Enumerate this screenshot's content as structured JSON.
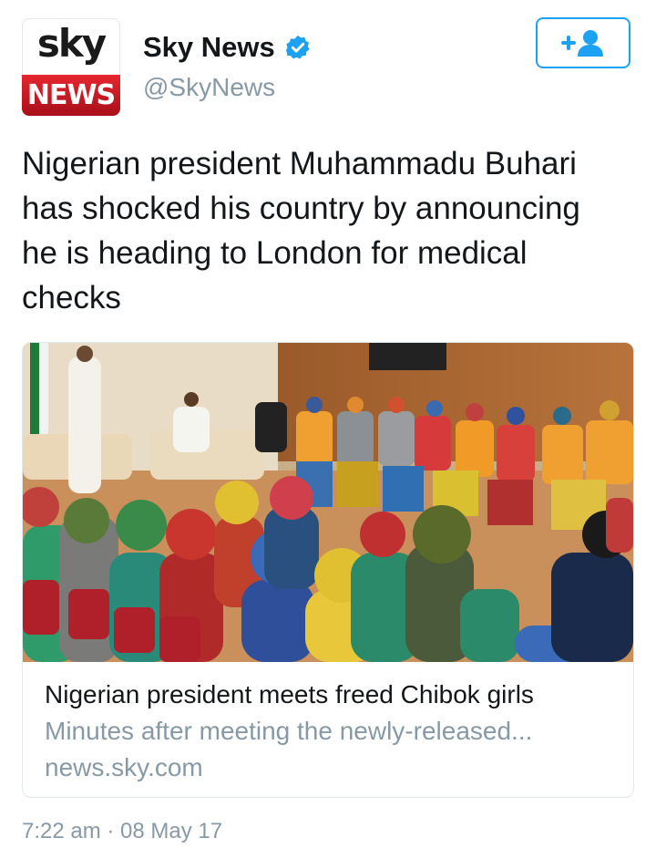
{
  "author": {
    "logo_top": "sky",
    "logo_bottom": "NEWS",
    "display_name": "Sky News",
    "handle": "@SkyNews",
    "verified": true
  },
  "follow_button": {
    "icon": "follow-user-icon",
    "color": "#1da1f2"
  },
  "tweet": {
    "text": "Nigerian president Muhammadu Buhari has shocked his country by announcing he is heading to London for medical checks"
  },
  "card": {
    "title": "Nigerian president meets freed Chibok girls",
    "description": "Minutes after meeting the newly-released...",
    "domain": "news.sky.com"
  },
  "timestamp": "7:22 am · 08 May 17"
}
